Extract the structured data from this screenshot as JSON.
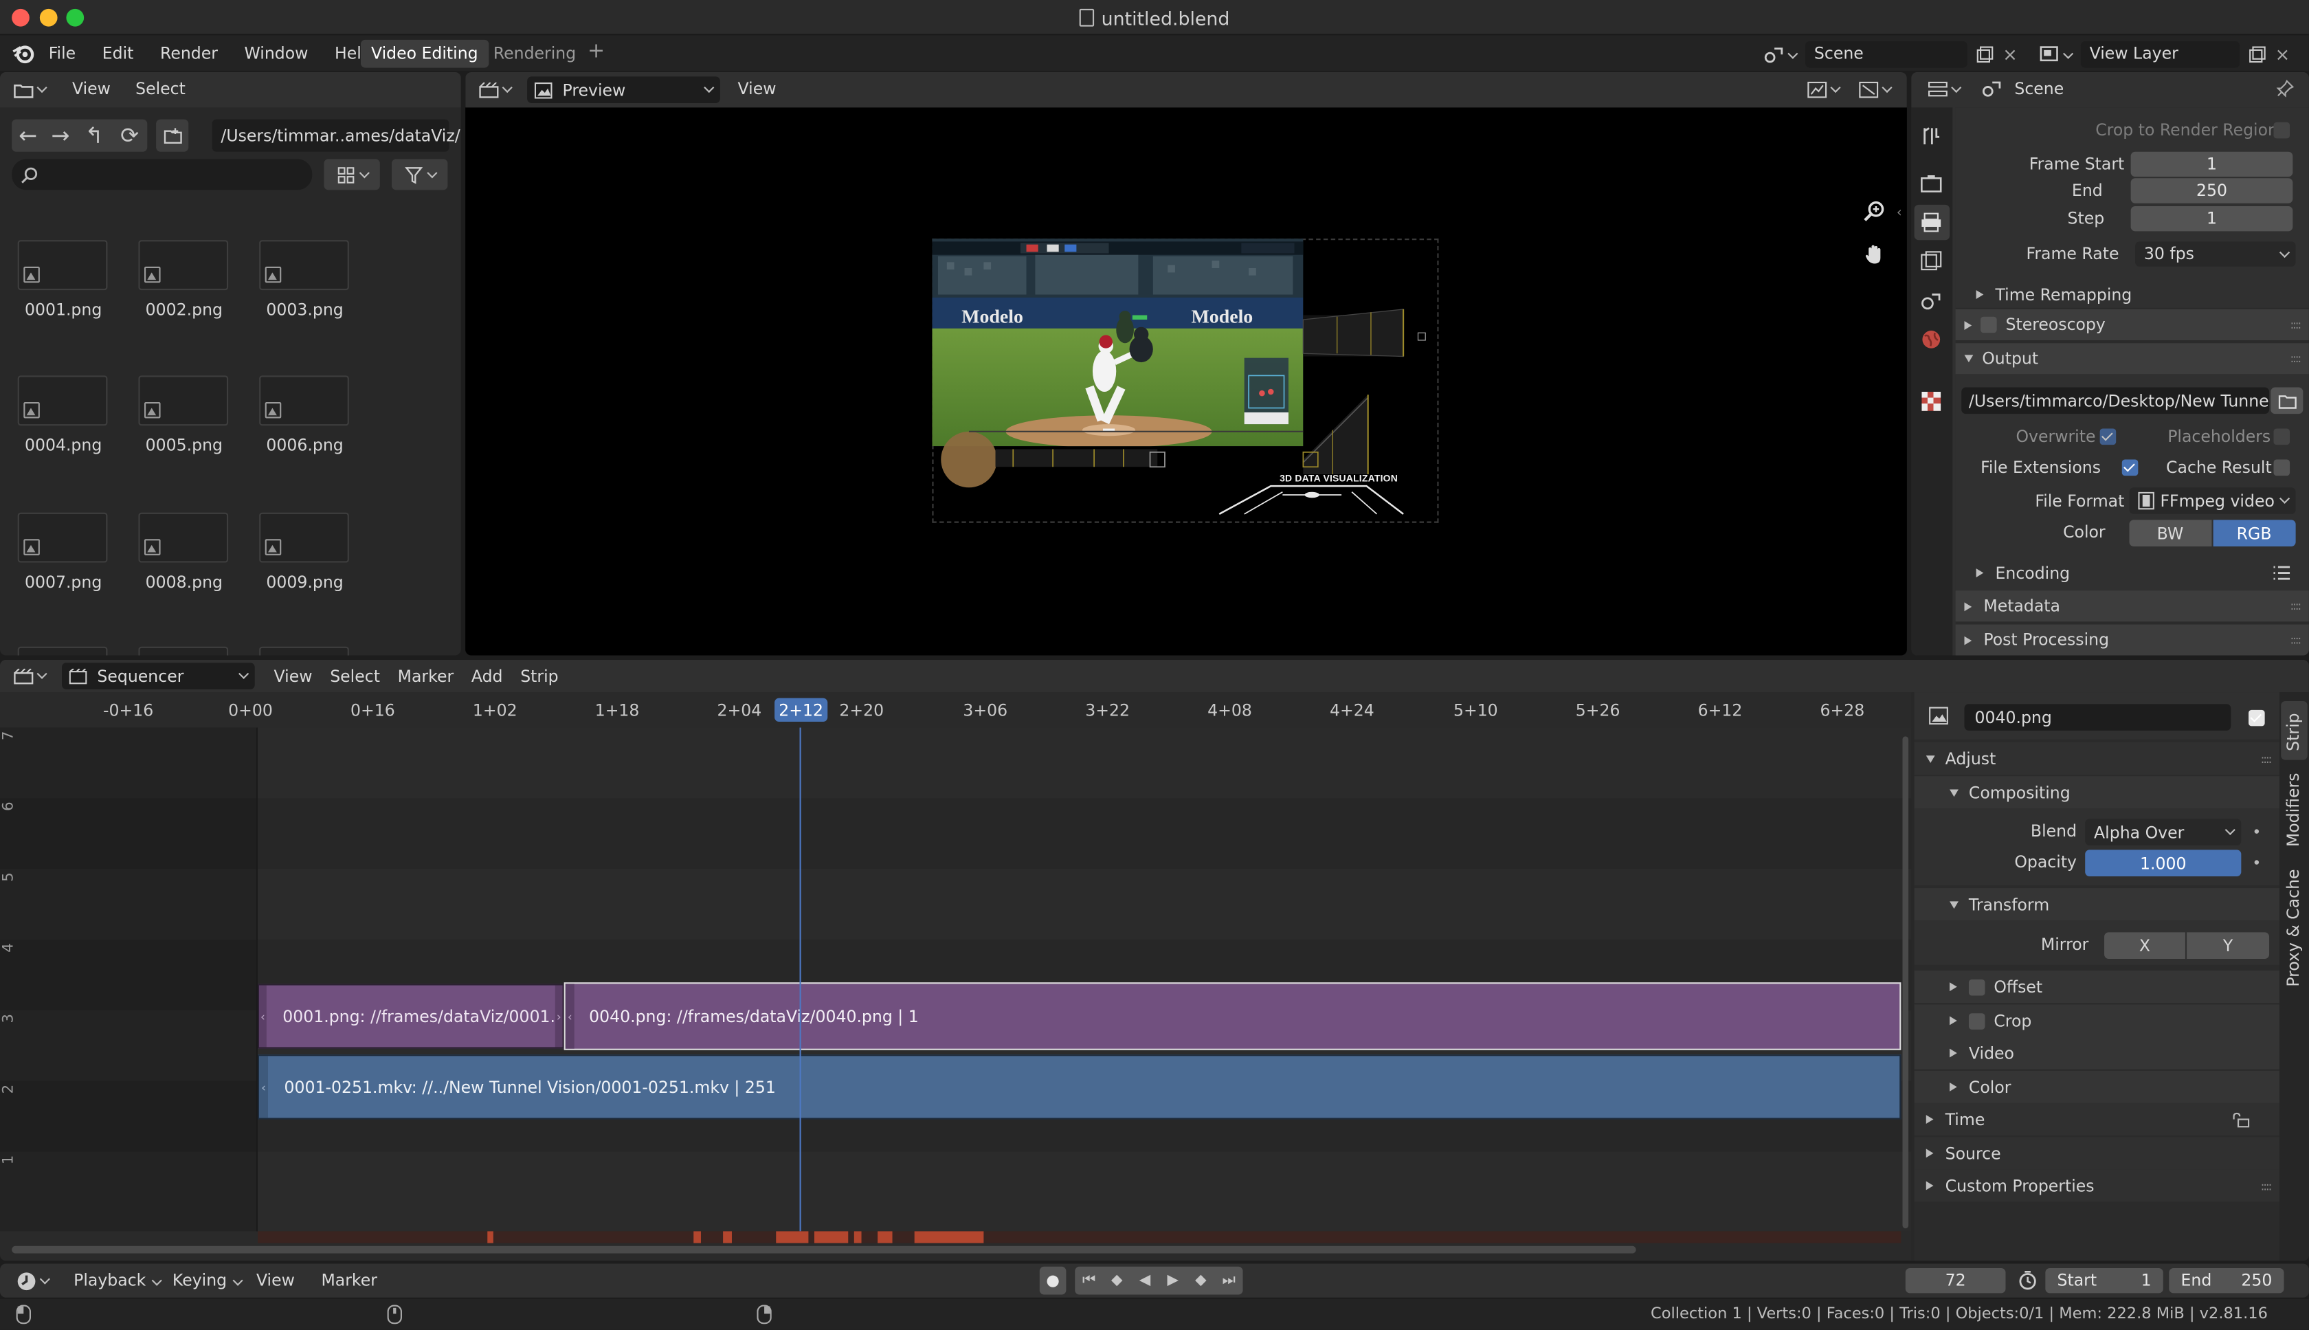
{
  "window": {
    "title": "untitled.blend"
  },
  "topbar": {
    "menus": [
      "File",
      "Edit",
      "Render",
      "Window",
      "Help"
    ],
    "workspaces": [
      "Video Editing",
      "Rendering"
    ],
    "add_workspace": "+",
    "scene": "Scene",
    "view_layer": "View Layer"
  },
  "file_browser": {
    "menus": [
      "View",
      "Select"
    ],
    "path": "/Users/timmar..ames/dataViz/",
    "search_placeholder": "",
    "files": [
      "0001.png",
      "0002.png",
      "0003.png",
      "0004.png",
      "0005.png",
      "0006.png",
      "0007.png",
      "0008.png",
      "0009.png"
    ]
  },
  "preview": {
    "mode": "Preview",
    "menu": "View",
    "overlay_caption": "3D DATA VISUALIZATION",
    "colors": {
      "viewport_bg": "#000000"
    }
  },
  "properties": {
    "header": "Scene",
    "crop_to_render_region": "Crop to Render Region",
    "frame_start_label": "Frame Start",
    "frame_start": "1",
    "end_label": "End",
    "end": "250",
    "step_label": "Step",
    "step": "1",
    "frame_rate_label": "Frame Rate",
    "frame_rate": "30 fps",
    "time_remapping": "Time Remapping",
    "stereoscopy": "Stereoscopy",
    "output": "Output",
    "output_path": "/Users/timmarco/Desktop/New Tunnel ..",
    "overwrite": "Overwrite",
    "placeholders": "Placeholders",
    "file_extensions": "File Extensions",
    "cache_result": "Cache Result",
    "file_format_label": "File Format",
    "file_format": "FFmpeg video",
    "color_label": "Color",
    "color_bw": "BW",
    "color_rgb": "RGB",
    "encoding": "Encoding",
    "metadata": "Metadata",
    "post_processing": "Post Processing"
  },
  "sequencer": {
    "editor": "Sequencer",
    "menus": [
      "View",
      "Select",
      "Marker",
      "Add",
      "Strip"
    ],
    "ruler": [
      "-0+16",
      "0+00",
      "0+16",
      "1+02",
      "1+18",
      "2+04",
      "2+12",
      "2+20",
      "3+06",
      "3+22",
      "4+08",
      "4+24",
      "5+10",
      "5+26",
      "6+12",
      "6+28"
    ],
    "current_frame_label": "2+12",
    "channels": [
      "7",
      "6",
      "5",
      "4",
      "3",
      "2",
      "1"
    ],
    "strips": [
      {
        "label": "0001.png: //frames/dataViz/0001.",
        "channel": 3
      },
      {
        "label": "0040.png: //frames/dataViz/0040.png | 1",
        "channel": 3
      },
      {
        "label": "0001-0251.mkv: //../New Tunnel Vision/0001-0251.mkv | 251",
        "channel": 2
      }
    ],
    "colors": {
      "image_strip": "#71507f",
      "movie_strip": "#4a6a92",
      "playhead": "#4d78c4"
    }
  },
  "strip_panel": {
    "name": "0040.png",
    "adjust": "Adjust",
    "compositing": "Compositing",
    "blend_label": "Blend",
    "blend": "Alpha Over",
    "opacity_label": "Opacity",
    "opacity": "1.000",
    "transform": "Transform",
    "mirror_label": "Mirror",
    "mirror_x": "X",
    "mirror_y": "Y",
    "offset": "Offset",
    "crop": "Crop",
    "video": "Video",
    "color": "Color",
    "time": "Time",
    "source": "Source",
    "custom_properties": "Custom Properties",
    "tabs": [
      "Strip",
      "Modifiers",
      "Proxy & Cache"
    ]
  },
  "timeline": {
    "menus": [
      "Playback",
      "Keying",
      "View",
      "Marker"
    ],
    "current_frame": "72",
    "start_label": "Start",
    "start": "1",
    "end_label": "End",
    "end": "250"
  },
  "statusbar": {
    "text": "Collection 1 | Verts:0 | Faces:0 | Tris:0 | Objects:0/1 | Mem: 222.8 MiB | v2.81.16"
  }
}
